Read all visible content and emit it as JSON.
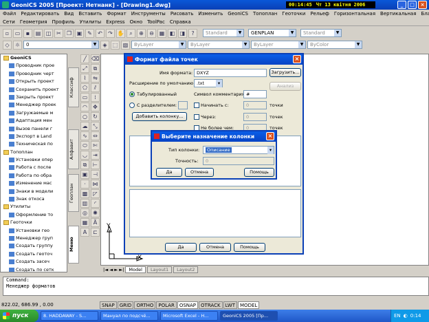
{
  "window": {
    "title": "GeoniCS 2005 [Проект: Нетнанк] - [Drawing1.dwg]",
    "clock_time": "00:14:45",
    "clock_date": "Чт 13 квітня 2006"
  },
  "menu_row1": [
    "Файл",
    "Редактировать",
    "Вид",
    "Вставить",
    "Формат",
    "Инструменты",
    "Рисовать",
    "Изменить",
    "GeoniCS",
    "Топоплан",
    "Геоточки",
    "Рельеф",
    "Горизонтальная",
    "Вертикальная",
    "Благоустройство"
  ],
  "menu_row2": [
    "Сети",
    "Геометрия",
    "Профиль",
    "Утилиты",
    "Express",
    "Окно",
    "ToolPac",
    "Справка"
  ],
  "toolbar": {
    "style1": "Standard",
    "style2": "GENPLAN",
    "style3": "Standard",
    "layer": "0",
    "linetype1": "ByLayer",
    "linetype2": "ByLayer",
    "lineweight": "ByLayer",
    "color": "ByColor"
  },
  "left_panel": {
    "tabs": [
      "Классиф",
      "Алфавит",
      "Геоплан",
      "Меню"
    ],
    "items": [
      {
        "label": "GeoniCS",
        "type": "folder"
      },
      {
        "label": "Проводник прое",
        "type": "item"
      },
      {
        "label": "Проводник черт",
        "type": "item"
      },
      {
        "label": "Открыть проект",
        "type": "item"
      },
      {
        "label": "Сохранить проект",
        "type": "item"
      },
      {
        "label": "Закрыть проект",
        "type": "item"
      },
      {
        "label": "Менеджер проек",
        "type": "item"
      },
      {
        "label": "Загружаемые м",
        "type": "item"
      },
      {
        "label": "Адаптация мен",
        "type": "item"
      },
      {
        "label": "Вызов панели г",
        "type": "item"
      },
      {
        "label": "Экспорт в Land",
        "type": "item"
      },
      {
        "label": "Техническая по",
        "type": "item"
      },
      {
        "label": "Топоплан",
        "type": "folder"
      },
      {
        "label": "Установки опер",
        "type": "item"
      },
      {
        "label": "Работа с после",
        "type": "item"
      },
      {
        "label": "Работа по обра",
        "type": "item"
      },
      {
        "label": "Изменение мас",
        "type": "item"
      },
      {
        "label": "Знаки в модели",
        "type": "item"
      },
      {
        "label": "Знак откоса",
        "type": "item"
      },
      {
        "label": "Утилиты",
        "type": "folder"
      },
      {
        "label": "Оформление то",
        "type": "item"
      },
      {
        "label": "Геоточки",
        "type": "folder"
      },
      {
        "label": "Установки гео",
        "type": "item"
      },
      {
        "label": "Менеджер груп",
        "type": "item"
      },
      {
        "label": "Создать группу",
        "type": "item"
      },
      {
        "label": "Создать геоточ",
        "type": "item"
      },
      {
        "label": "Создать засеч",
        "type": "item"
      },
      {
        "label": "Создать по сетк",
        "type": "item"
      },
      {
        "label": "Создать по ул",
        "type": "item"
      },
      {
        "label": "Создать по при",
        "type": "item"
      },
      {
        "label": "Создать по пов",
        "type": "item"
      },
      {
        "label": "Тахеометриче",
        "type": "item"
      }
    ]
  },
  "dialog": {
    "title": "Формат файла точек",
    "format_name_label": "Имя формата:",
    "format_name_value": "DXYZ",
    "load_button": "Загрузить...",
    "ext_label": "Расширение по умолчанию:",
    "ext_value": ".txt",
    "analyze_button": "Анализ",
    "radio_tab": "Табулированный",
    "radio_sep": "С разделителем:",
    "comment_label": "Символ комментария:",
    "comment_value": "#",
    "start_label": "Начинать с:",
    "start_value": "0",
    "start_unit": "точки",
    "through_label": "Через:",
    "through_value": "0",
    "through_unit": "точек",
    "nomore_label": "Не более чем:",
    "nomore_value": "0",
    "nomore_unit": "точек",
    "add_column_button": "Добавить колонку...",
    "ok_button": "Да",
    "cancel_button": "Отмена",
    "help_button": "Помощь"
  },
  "subdialog": {
    "title": "Выберите назначение колонки",
    "type_label": "Тип колонки:",
    "type_value": "Описание",
    "precision_label": "Точность:",
    "precision_value": "0",
    "ok_button": "Да",
    "cancel_button": "Отмена",
    "help_button": "Помощь"
  },
  "layout_tabs": [
    "Model",
    "Layout1",
    "Layout2"
  ],
  "command": {
    "line1": "Command:",
    "line2": "Менеджер форматов"
  },
  "status": {
    "coords": "822.02, 686.99 , 0.00",
    "buttons": [
      {
        "label": "SNAP",
        "on": false
      },
      {
        "label": "GRID",
        "on": false
      },
      {
        "label": "ORTHO",
        "on": false
      },
      {
        "label": "POLAR",
        "on": false
      },
      {
        "label": "OSNAP",
        "on": true
      },
      {
        "label": "OTRACK",
        "on": false
      },
      {
        "label": "LWT",
        "on": false
      },
      {
        "label": "MODEL",
        "on": true
      }
    ]
  },
  "taskbar": {
    "start_label": "пуск",
    "tasks": [
      "8. HADDAWAY - S...",
      "Мануал по подсчё...",
      "Microsoft Excel - H...",
      "GeoniCS 2005 [Пр..."
    ],
    "lang": "EN",
    "time": "0:14"
  },
  "axes": {
    "y": "Y",
    "x": "X"
  }
}
